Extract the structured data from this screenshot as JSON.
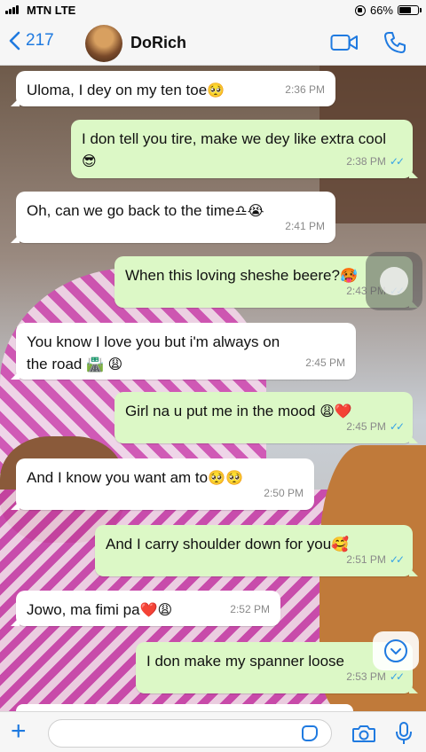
{
  "status_bar": {
    "carrier": "MTN  LTE",
    "battery": "66%",
    "battery_level": 0.66
  },
  "header": {
    "back_count": "217",
    "contact_name": "DoRich",
    "icons": [
      "video-icon",
      "phone-icon"
    ]
  },
  "messages": [
    {
      "dir": "in",
      "text": "Uloma, I dey on my ten toe",
      "emoji": "🥺",
      "time": "2:36 PM"
    },
    {
      "dir": "out",
      "text": "I don tell you tire, make we dey like extra cool",
      "emoji": "😎",
      "time": "2:38 PM",
      "status": "read"
    },
    {
      "dir": "in",
      "text": "Oh, can we go back to the time",
      "emoji": "♎😭",
      "time": "2:41 PM"
    },
    {
      "dir": "out",
      "text": "When this loving sheshe beere?",
      "emoji": "🥵",
      "time": "2:43 PM",
      "status": "read"
    },
    {
      "dir": "in",
      "text": "You know I love you but i'm always on the road",
      "emoji": "🛣️ 😩",
      "time": "2:45 PM"
    },
    {
      "dir": "out",
      "text": "Girl na u put me in the mood",
      "emoji": "😩❤️",
      "time": "2:45 PM",
      "status": "read"
    },
    {
      "dir": "in",
      "text": "And I know you want am to",
      "emoji": "🥺🥺",
      "time": "2:50 PM"
    },
    {
      "dir": "out",
      "text": "And I carry shoulder down for you",
      "emoji": "🥰",
      "time": "2:51 PM",
      "status": "read"
    },
    {
      "dir": "in",
      "text": "Jowo, ma fimi pa",
      "emoji": "❤️😩",
      "time": "2:52 PM"
    },
    {
      "dir": "out",
      "text": "I don make my spanner loose",
      "emoji": "",
      "time": "2:53 PM",
      "status": "read"
    }
  ],
  "composer": {
    "value": "",
    "icons": [
      "plus-icon",
      "sticker-icon",
      "camera-icon",
      "mic-icon"
    ]
  },
  "colors": {
    "accent": "#1f7ae0",
    "outgoing_bubble": "#dcf8c6",
    "incoming_bubble": "#ffffff",
    "read_ticks": "#36a3e6"
  }
}
